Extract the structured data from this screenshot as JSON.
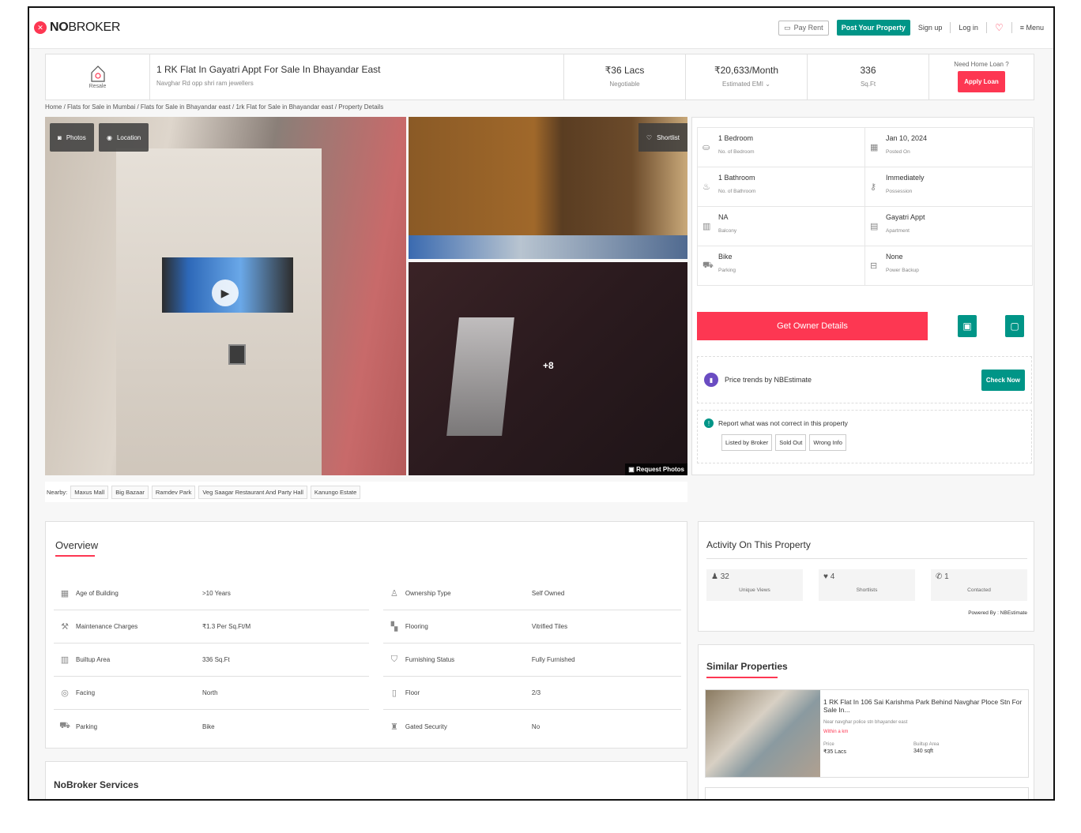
{
  "header": {
    "logo_prefix": "NO",
    "logo_suffix": "BROKER",
    "pay_rent": "Pay Rent",
    "post_property": "Post Your Property",
    "sign_up": "Sign up",
    "log_in": "Log in",
    "menu": "Menu"
  },
  "summary": {
    "type_label": "Resale",
    "title": "1 RK Flat In Gayatri Appt For Sale In Bhayandar East",
    "address": "Navghar Rd opp shri ram jewellers",
    "price": "₹36 Lacs",
    "price_sub": "Negotiable",
    "emi": "₹20,633/Month",
    "emi_sub": "Estimated EMI ⌄",
    "area": "336",
    "area_unit": "Sq.Ft",
    "loan_q": "Need Home Loan ?",
    "apply_loan": "Apply Loan"
  },
  "breadcrumb": "Home / Flats for Sale in Mumbai / Flats for Sale in Bhayandar east / 1rk Flat for Sale in Bhayandar east / Property Details",
  "gallery": {
    "photos": "Photos",
    "location": "Location",
    "shortlist": "Shortlist",
    "more": "+8",
    "request_photos": "Request Photos"
  },
  "nearby": {
    "label": "Nearby:",
    "places": [
      "Maxus Mall",
      "Big Bazaar",
      "Ramdev Park",
      "Veg Saagar Restaurant And Party Hall",
      "Kanungo Estate"
    ]
  },
  "details": [
    {
      "title": "1 Bedroom",
      "sub": "No. of Bedroom",
      "icon": "bed-icon"
    },
    {
      "title": "Jan 10, 2024",
      "sub": "Posted On",
      "icon": "calendar-icon"
    },
    {
      "title": "1 Bathroom",
      "sub": "No. of Bathroom",
      "icon": "bath-icon"
    },
    {
      "title": "Immediately",
      "sub": "Possession",
      "icon": "key-icon"
    },
    {
      "title": "NA",
      "sub": "Balcony",
      "icon": "balcony-icon"
    },
    {
      "title": "Gayatri Appt",
      "sub": "Apartment",
      "icon": "building-icon"
    },
    {
      "title": "Bike",
      "sub": "Parking",
      "icon": "car-icon"
    },
    {
      "title": "None",
      "sub": "Power Backup",
      "icon": "battery-icon"
    }
  ],
  "actions": {
    "owner_details": "Get Owner Details",
    "price_trends": "Price trends by NBEstimate",
    "check_now": "Check Now",
    "report_q": "Report what was not correct in this property",
    "report_opts": [
      "Listed by Broker",
      "Sold Out",
      "Wrong Info"
    ]
  },
  "overview": {
    "title": "Overview",
    "rows": [
      [
        {
          "label": "Age of Building",
          "value": ">10 Years",
          "icon": "building-age-icon"
        },
        {
          "label": "Ownership Type",
          "value": "Self Owned",
          "icon": "ownership-icon"
        }
      ],
      [
        {
          "label": "Maintenance Charges",
          "value": "₹1.3 Per Sq.Ft/M",
          "icon": "maintenance-icon"
        },
        {
          "label": "Flooring",
          "value": "Vitrified Tiles",
          "icon": "flooring-icon"
        }
      ],
      [
        {
          "label": "Builtup Area",
          "value": "336 Sq.Ft",
          "icon": "area-icon"
        },
        {
          "label": "Furnishing Status",
          "value": "Fully Furnished",
          "icon": "furnishing-icon"
        }
      ],
      [
        {
          "label": "Facing",
          "value": "North",
          "icon": "compass-icon"
        },
        {
          "label": "Floor",
          "value": "2/3",
          "icon": "floor-icon"
        }
      ],
      [
        {
          "label": "Parking",
          "value": "Bike",
          "icon": "car-icon"
        },
        {
          "label": "Gated Security",
          "value": "No",
          "icon": "security-icon"
        }
      ]
    ]
  },
  "services": {
    "title": "NoBroker Services"
  },
  "activity": {
    "title": "Activity On This Property",
    "views": "32",
    "views_label": "Unique Views",
    "shortlists": "4",
    "shortlists_label": "Shortlists",
    "contacted": "1",
    "contacted_label": "Contacted",
    "powered": "Powered By : NBEstimate"
  },
  "similar": {
    "title": "Similar Properties",
    "card": {
      "title": "1 RK Flat In 106 Sai Karishma Park Behind Navghar Ploce Stn For Sale In...",
      "address": "Near navghar police stn bhayander east",
      "distance": "Within a km",
      "price_label": "Price",
      "price": "₹35 Lacs",
      "area_label": "Builtup Area",
      "area": "340 sqft"
    }
  },
  "colors": {
    "brand": "#fd3752",
    "teal": "#009587"
  }
}
